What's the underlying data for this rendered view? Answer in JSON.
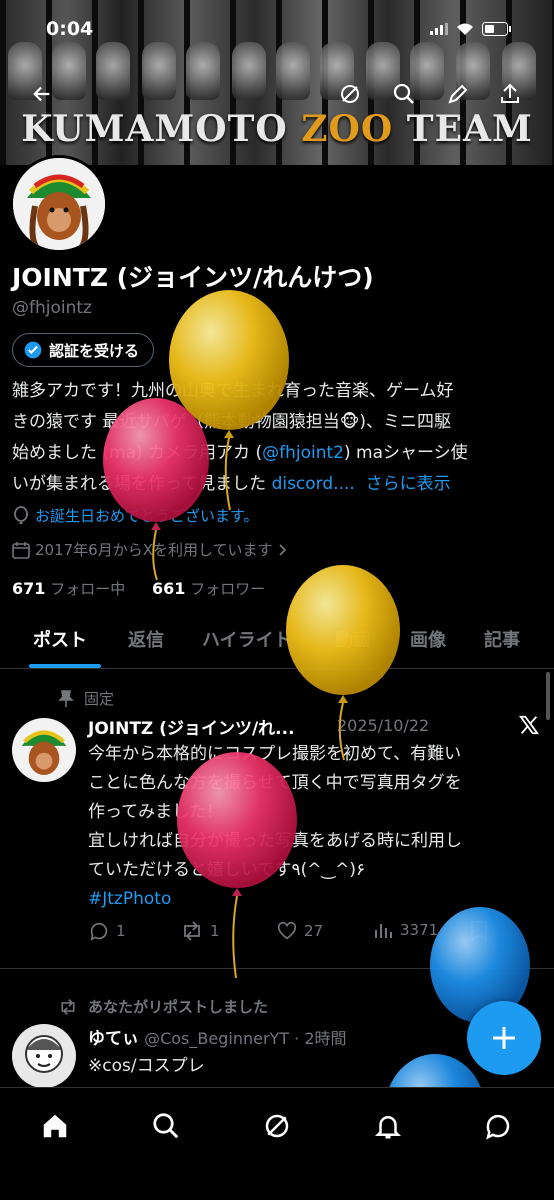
{
  "status_bar": {
    "time": "0:04"
  },
  "banner": {
    "title_part1": "KUMAMOTO ",
    "title_part2": "ZOO",
    "title_part3": " TEAM"
  },
  "profile": {
    "name": "JOINTZ (ジョインツ/れんけつ)",
    "handle": "@fhjointz",
    "verify_label": "認証を受ける",
    "bio_line1": "雑多アカです！九州の山奥で生まれ育った音楽、ゲーム好",
    "bio_line2": "きの猿です 最近サバゲ（熊本動物園猿担当🐵)、ミニ四駆",
    "bio_line3a": "始めました (ma) カメラ用アカ (",
    "bio_line3_link": "@fhjoint2",
    "bio_line3b": ") maシャーシ使",
    "bio_line4": "いが集まれる場を作って見ました ",
    "bio_line4_link": "discord....",
    "show_more": "さらに表示",
    "birthday": "お誕生日おめでとうございます。",
    "joined": "2017年6月からXを利用しています",
    "following_count": "671",
    "following_label": "フォロー中",
    "followers_count": "661",
    "followers_label": "フォロワー"
  },
  "tabs": [
    "ポスト",
    "返信",
    "ハイライト",
    "動画",
    "画像",
    "記事"
  ],
  "pinned_post": {
    "pinned_label": "固定",
    "name": "JOINTZ (ジョインツ/れ...",
    "date": "2025/10/22",
    "line1": "今年から本格的にコスプレ撮影を初めて、有難い",
    "line2": "ことに色んな方を撮らせて頂く中で写真用タグを",
    "line3": "作ってみました！",
    "line4": "宜しければ自分が撮った写真をあげる時に利用し",
    "line5": "ていただけると嬉しいです٩(^‿^)۶",
    "hashtag": "#JtzPhoto",
    "replies": "1",
    "reposts": "1",
    "likes": "27",
    "views": "3371"
  },
  "repost_post": {
    "repost_label": "あなたがリポストしました",
    "name": "ゆてぃ",
    "handle_time": "@Cos_BeginnerYT · 2時間",
    "text": "※cos/コスプレ"
  },
  "colors": {
    "accent": "#1d9bf0",
    "balloon_yellow": "#f2c21c",
    "balloon_pink": "#f0356b",
    "balloon_blue": "#1f8fe8"
  },
  "icons": [
    "back-icon",
    "grok-icon",
    "search-icon",
    "edit-icon",
    "share-icon",
    "verified-badge-icon",
    "balloon-location-icon",
    "calendar-icon",
    "pin-icon",
    "x-logo-icon",
    "reply-icon",
    "repost-icon",
    "like-icon",
    "views-icon",
    "bookmark-icon",
    "plus-icon",
    "home-icon",
    "notifications-icon",
    "messages-icon"
  ]
}
